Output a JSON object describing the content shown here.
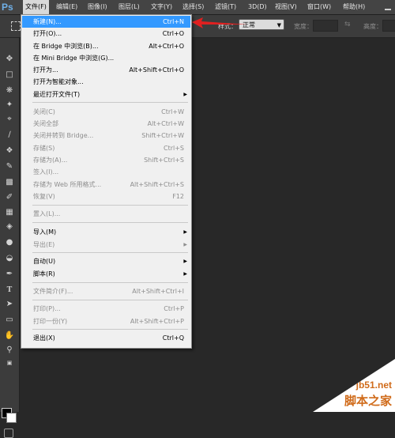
{
  "app": {
    "logo": "Ps"
  },
  "menubar": {
    "items": [
      "文件(F)",
      "编辑(E)",
      "图像(I)",
      "图层(L)",
      "文字(Y)",
      "选择(S)",
      "滤镜(T)",
      "3D(D)",
      "视图(V)",
      "窗口(W)",
      "帮助(H)"
    ],
    "active_item": "文件(F)"
  },
  "options_bar": {
    "style_label": "样式：",
    "style_value": "正常",
    "width_label": "宽度：",
    "height_label": "高度："
  },
  "file_menu": {
    "items": [
      {
        "label": "新建(N)...",
        "shortcut": "Ctrl+N",
        "state": "highlighted"
      },
      {
        "label": "打开(O)...",
        "shortcut": "Ctrl+O",
        "state": "enabled"
      },
      {
        "label": "在 Bridge 中浏览(B)...",
        "shortcut": "Alt+Ctrl+O",
        "state": "enabled"
      },
      {
        "label": "在 Mini Bridge 中浏览(G)...",
        "shortcut": "",
        "state": "enabled"
      },
      {
        "label": "打开为...",
        "shortcut": "Alt+Shift+Ctrl+O",
        "state": "enabled"
      },
      {
        "label": "打开为智能对象...",
        "shortcut": "",
        "state": "enabled"
      },
      {
        "label": "最近打开文件(T)",
        "shortcut": "",
        "state": "enabled",
        "submenu": true
      },
      {
        "label": "关闭(C)",
        "shortcut": "Ctrl+W",
        "state": "disabled"
      },
      {
        "label": "关闭全部",
        "shortcut": "Alt+Ctrl+W",
        "state": "disabled"
      },
      {
        "label": "关闭并转到 Bridge...",
        "shortcut": "Shift+Ctrl+W",
        "state": "disabled"
      },
      {
        "label": "存储(S)",
        "shortcut": "Ctrl+S",
        "state": "disabled"
      },
      {
        "label": "存储为(A)...",
        "shortcut": "Shift+Ctrl+S",
        "state": "disabled"
      },
      {
        "label": "签入(I)...",
        "shortcut": "",
        "state": "disabled"
      },
      {
        "label": "存储为 Web 所用格式...",
        "shortcut": "Alt+Shift+Ctrl+S",
        "state": "disabled"
      },
      {
        "label": "恢复(V)",
        "shortcut": "F12",
        "state": "disabled"
      },
      {
        "label": "置入(L)...",
        "shortcut": "",
        "state": "disabled"
      },
      {
        "label": "导入(M)",
        "shortcut": "",
        "state": "enabled",
        "submenu": true
      },
      {
        "label": "导出(E)",
        "shortcut": "",
        "state": "disabled",
        "submenu": true
      },
      {
        "label": "自动(U)",
        "shortcut": "",
        "state": "enabled",
        "submenu": true
      },
      {
        "label": "脚本(R)",
        "shortcut": "",
        "state": "enabled",
        "submenu": true
      },
      {
        "label": "文件简介(F)...",
        "shortcut": "Alt+Shift+Ctrl+I",
        "state": "disabled"
      },
      {
        "label": "打印(P)...",
        "shortcut": "Ctrl+P",
        "state": "disabled"
      },
      {
        "label": "打印一份(Y)",
        "shortcut": "Alt+Shift+Ctrl+P",
        "state": "disabled"
      },
      {
        "label": "退出(X)",
        "shortcut": "Ctrl+Q",
        "state": "enabled"
      }
    ]
  },
  "tools": [
    "move-tool",
    "marquee-tool",
    "lasso-tool",
    "quick-selection-tool",
    "crop-tool",
    "eyedropper-tool",
    "healing-brush-tool",
    "brush-tool",
    "clone-stamp-tool",
    "history-brush-tool",
    "eraser-tool",
    "gradient-tool",
    "blur-tool",
    "dodge-tool",
    "pen-tool",
    "type-tool",
    "path-selection-tool",
    "rectangle-tool",
    "hand-tool",
    "zoom-tool"
  ],
  "colors": {
    "menu_highlight": "#3399ff",
    "annotation_arrow": "#e02020",
    "watermark": "#d06b1a"
  },
  "watermark": {
    "site": "jb51.net",
    "text": "脚本之家"
  }
}
